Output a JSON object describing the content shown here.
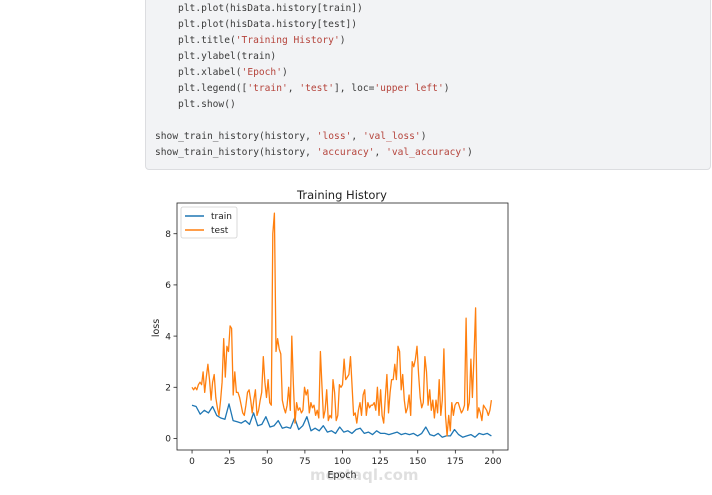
{
  "code": {
    "lines": [
      {
        "indent": true,
        "parts": [
          "plt.plot(hisData.history[train])"
        ]
      },
      {
        "indent": true,
        "parts": [
          "plt.plot(hisData.history[test])"
        ]
      },
      {
        "indent": true,
        "parts": [
          "plt.title(",
          "'Training History'",
          ")"
        ]
      },
      {
        "indent": true,
        "parts": [
          "plt.ylabel(train)"
        ]
      },
      {
        "indent": true,
        "parts": [
          "plt.xlabel(",
          "'Epoch'",
          ")"
        ]
      },
      {
        "indent": true,
        "parts": [
          "plt.legend([",
          "'train'",
          ", ",
          "'test'",
          "], loc=",
          "'upper left'",
          ")"
        ]
      },
      {
        "indent": true,
        "parts": [
          "plt.show()"
        ]
      },
      {
        "indent": false,
        "parts": [
          ""
        ]
      },
      {
        "indent": false,
        "parts": [
          "show_train_history(history, ",
          "'loss'",
          ", ",
          "'val_loss'",
          ")"
        ]
      },
      {
        "indent": false,
        "parts": [
          "show_train_history(history, ",
          "'accuracy'",
          ", ",
          "'val_accuracy'",
          ")"
        ]
      }
    ]
  },
  "watermark": "mostaql.com",
  "chart_data": {
    "type": "line",
    "title": "Training History",
    "xlabel": "Epoch",
    "ylabel": "loss",
    "xlim": [
      -10,
      210
    ],
    "ylim": [
      -0.45,
      9.2
    ],
    "epoch_range": [
      0,
      199
    ],
    "xticks": [
      0,
      25,
      50,
      75,
      100,
      125,
      150,
      175,
      200
    ],
    "yticks": [
      0,
      2,
      4,
      6,
      8
    ],
    "legend": "upper-left",
    "grid": false,
    "series": [
      {
        "name": "train",
        "color": "#1f77b4",
        "values": [
          1.3,
          1.25,
          0.95,
          1.1,
          1.0,
          1.25,
          0.9,
          0.8,
          0.75,
          1.35,
          0.7,
          0.65,
          0.6,
          0.7,
          0.55,
          1.0,
          0.5,
          0.55,
          0.85,
          0.45,
          0.5,
          0.7,
          0.4,
          0.45,
          0.4,
          0.8,
          0.35,
          0.5,
          0.85,
          0.3,
          0.4,
          0.3,
          0.5,
          0.25,
          0.3,
          0.2,
          0.45,
          0.25,
          0.3,
          0.2,
          0.35,
          0.4,
          0.2,
          0.25,
          0.15,
          0.3,
          0.2,
          0.2,
          0.15,
          0.2,
          0.25,
          0.15,
          0.2,
          0.15,
          0.2,
          0.1,
          0.2,
          0.45,
          0.15,
          0.1,
          0.2,
          0.05,
          0.1,
          0.1,
          0.35,
          0.15,
          0.05,
          0.1,
          0.15,
          0.05,
          0.2,
          0.15,
          0.2,
          0.1
        ]
      },
      {
        "name": "test",
        "color": "#ff7f0e",
        "values": [
          2.0,
          1.9,
          2.0,
          1.9,
          2.1,
          2.2,
          2.1,
          2.6,
          1.8,
          2.4,
          2.9,
          2.3,
          1.5,
          2.2,
          2.5,
          1.6,
          1.2,
          0.9,
          1.5,
          2.2,
          3.9,
          2.4,
          3.6,
          3.4,
          4.4,
          4.3,
          1.7,
          2.6,
          1.8,
          1.8,
          1.6,
          1.3,
          1.0,
          0.9,
          1.3,
          1.8,
          1.9,
          1.5,
          1.0,
          1.5,
          1.9,
          0.9,
          1.1,
          1.5,
          1.8,
          3.2,
          2.2,
          1.6,
          2.3,
          1.4,
          1.3,
          8.0,
          8.8,
          3.4,
          3.9,
          3.5,
          3.3,
          1.5,
          1.2,
          1.0,
          1.3,
          2.0,
          1.1,
          4.0,
          2.1,
          0.6,
          1.4,
          1.1,
          1.2,
          1.0,
          1.1,
          2.0,
          1.7,
          1.9,
          1.0,
          1.4,
          1.2,
          1.3,
          0.9,
          1.1,
          0.8,
          3.4,
          2.1,
          0.8,
          1.1,
          1.9,
          0.7,
          0.9,
          0.8,
          2.3,
          1.8,
          0.7,
          0.9,
          2.1,
          2.0,
          2.1,
          3.1,
          2.3,
          2.4,
          2.5,
          3.2,
          2.1,
          0.9,
          1.0,
          0.6,
          1.1,
          1.4,
          0.9,
          1.7,
          1.9,
          0.9,
          1.4,
          1.2,
          1.3,
          1.3,
          1.4,
          1.1,
          2.0,
          0.9,
          1.9,
          0.9,
          0.6,
          1.6,
          2.5,
          1.0,
          1.8,
          2.3,
          2.3,
          2.9,
          2.3,
          3.6,
          3.4,
          1.9,
          2.5,
          1.5,
          1.0,
          1.2,
          1.7,
          0.9,
          3.0,
          2.8,
          3.1,
          3.6,
          2.5,
          1.6,
          1.2,
          1.4,
          3.2,
          2.6,
          1.3,
          1.9,
          1.1,
          1.5,
          0.8,
          1.5,
          1.0,
          2.3,
          0.9,
          1.5,
          3.5,
          0.9,
          0.1,
          0.9,
          0.3,
          1.4,
          0.9,
          1.3,
          1.4,
          1.4,
          1.2,
          1.0,
          1.1,
          1.3,
          4.7,
          1.1,
          1.4,
          3.1,
          1.6,
          3.2,
          5.1,
          0.8,
          1.2,
          1.0,
          0.7,
          1.3,
          1.2,
          1.1,
          0.9,
          1.1,
          1.5
        ]
      }
    ]
  }
}
